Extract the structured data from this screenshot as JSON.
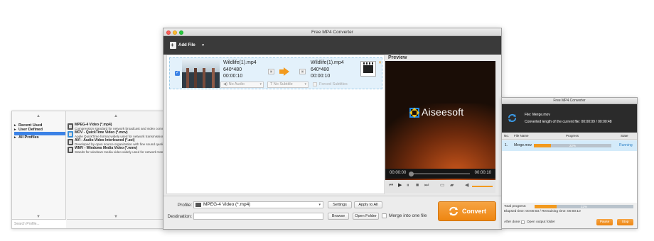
{
  "profile_window": {
    "tree_items": [
      {
        "label": "Recent Used",
        "caret": "▸"
      },
      {
        "label": "User Defined",
        "caret": "▸"
      },
      {
        "label": "All Profiles",
        "caret": "▸"
      }
    ],
    "formats": [
      {
        "title": "MPEG-4 Video (*.mp4)",
        "desc": "Compression standard for network broadcast and video communi..."
      },
      {
        "title": "MOV - QuickTime Video (*.mov)",
        "desc": "Apple QuickTime format widely used for network transmission an..."
      },
      {
        "title": "AVI - Audio-Video Interleaved (*.avi)",
        "desc": "Developed by open source organization with fine sound quality an..."
      },
      {
        "title": "WMV - Windows Media Video (*.wmv)",
        "desc": "Stands for windows media video widely used for network transmi..."
      }
    ],
    "search_placeholder": "Search Profile..."
  },
  "main_window": {
    "title": "Free MP4 Converter",
    "toolbar": {
      "add_file_label": "Add File",
      "add_file_dropdown": "▾"
    },
    "file": {
      "source_name": "Wildlife(1).mp4",
      "source_resolution": "640*480",
      "source_duration": "00:00:10",
      "output_name": "Wildlife(1).mp4",
      "output_resolution": "640*480",
      "output_duration": "00:00:10",
      "audio_select": "No Audio",
      "subtitle_select": "No Subtitle",
      "forced_subtitles_label": "Forced Subtitles"
    },
    "preview": {
      "label": "Preview",
      "logo_text": "Aiseesoft",
      "time_current": "00:00:00",
      "time_total": "00:00:10"
    },
    "bottom": {
      "profile_label": "Profile:",
      "profile_value": "MPEG-4 Video (*.mp4)",
      "settings_label": "Settings",
      "apply_all_label": "Apply to All",
      "destination_label": "Destination:",
      "destination_value": "",
      "browse_label": "Browse",
      "open_folder_label": "Open Folder",
      "merge_label": "Merge into one file",
      "convert_label": "Convert"
    }
  },
  "progress_window": {
    "title": "Free MP4 Converter",
    "file_label": "File: Merge.mov",
    "converted_length": "Converted length of the current file: 00:00:09 / 00:00:48",
    "columns": {
      "no": "No.",
      "file_name": "File Name",
      "progress": "Progress",
      "state": "State"
    },
    "row": {
      "no": "1.",
      "file": "Merge.mov",
      "progress_pct": 22,
      "progress_text": "22%",
      "state": "Running"
    },
    "total_progress_label": "Total progress:",
    "total_progress_pct": 22,
    "total_progress_text": "22%",
    "elapsed": "Elapsed time: 00:00:03 / Remaining time: 00:00:10",
    "after_done_label": "After done:",
    "open_output_label": "Open output folder",
    "pause_label": "Pause",
    "stop_label": "Stop"
  },
  "colors": {
    "accent": "#f29a1f",
    "selection": "#3b82e6",
    "running": "#2a7fc5"
  }
}
